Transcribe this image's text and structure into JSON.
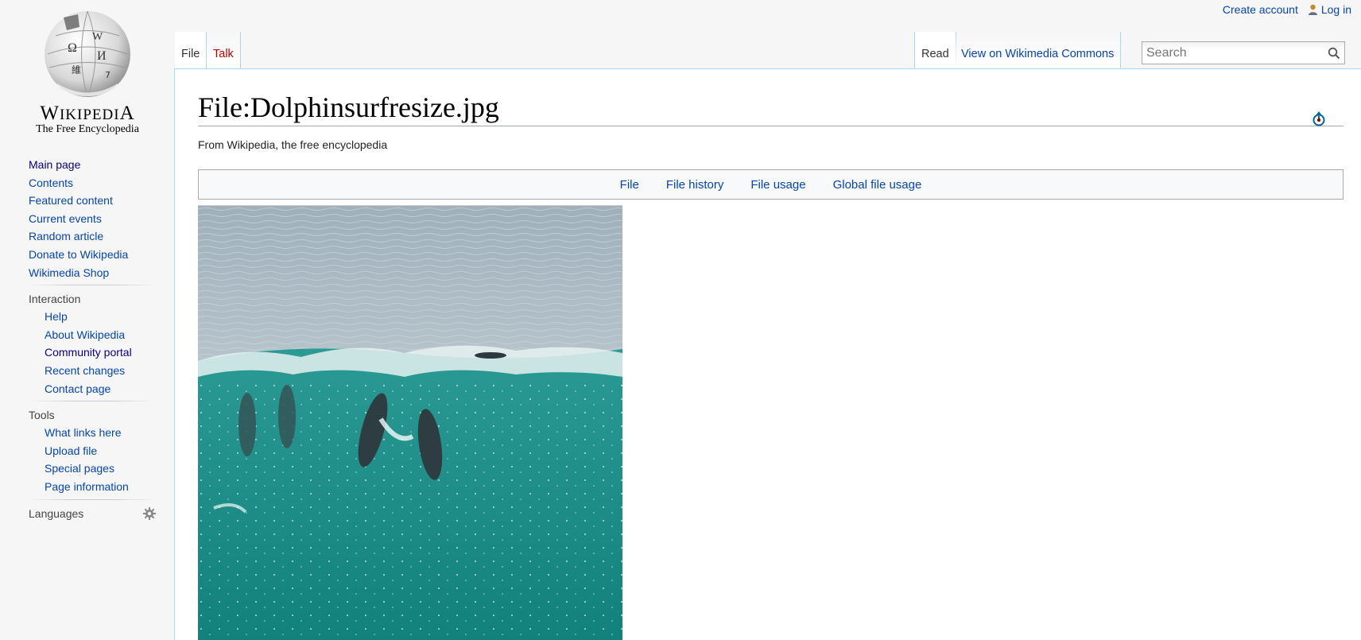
{
  "personal": {
    "create_account": "Create account",
    "log_in": "Log in"
  },
  "logo": {
    "wordmark_big": "W",
    "wordmark_small": "IKIPEDI",
    "wordmark_end": "A",
    "tagline": "The Free Encyclopedia"
  },
  "sidebar": {
    "navigation": [
      "Main page",
      "Contents",
      "Featured content",
      "Current events",
      "Random article",
      "Donate to Wikipedia",
      "Wikimedia Shop"
    ],
    "interaction_heading": "Interaction",
    "interaction": [
      "Help",
      "About Wikipedia",
      "Community portal",
      "Recent changes",
      "Contact page"
    ],
    "tools_heading": "Tools",
    "tools": [
      "What links here",
      "Upload file",
      "Special pages",
      "Page information"
    ],
    "languages_heading": "Languages"
  },
  "tabs": {
    "file": "File",
    "talk": "Talk",
    "read": "Read",
    "commons": "View on Wikimedia Commons"
  },
  "search": {
    "placeholder": "Search"
  },
  "page": {
    "title": "File:Dolphinsurfresize.jpg",
    "site_sub": "From Wikipedia, the free encyclopedia"
  },
  "filetoc": [
    "File",
    "File history",
    "File usage",
    "Global file usage"
  ],
  "colors": {
    "link": "#0645ad",
    "visited": "#0b0080",
    "border_blue": "#a7d7f9",
    "sea_top": "#a9b8c2",
    "sea_wave": "#1a8f8a"
  }
}
